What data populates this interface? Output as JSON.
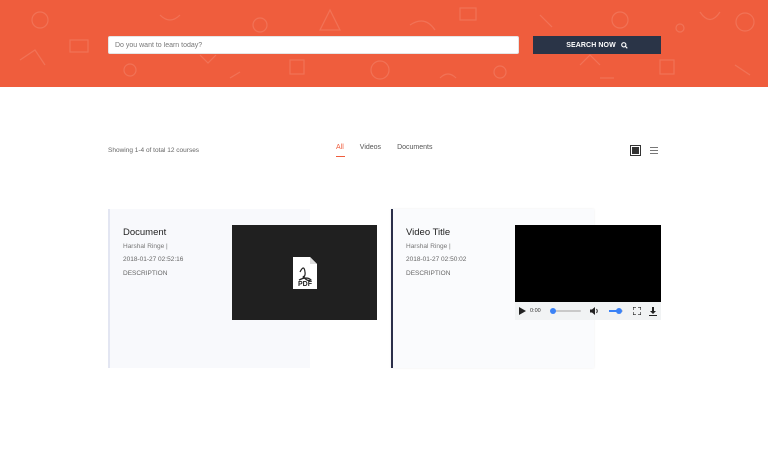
{
  "search": {
    "placeholder": "Do you want to learn today?",
    "button_label": "SEARCH NOW"
  },
  "results": {
    "summary": "Showing 1-4 of total 12 courses"
  },
  "filter_tabs": [
    {
      "label": "All",
      "active": true
    },
    {
      "label": "Videos",
      "active": false
    },
    {
      "label": "Documents",
      "active": false
    }
  ],
  "courses": [
    {
      "type": "document",
      "title": "Document",
      "author": "Harshal Ringe |",
      "date": "2018-01-27 02:52:16",
      "description": "DESCRIPTION",
      "thumbnail_icon": "pdf-file-icon",
      "thumbnail_label": "PDF"
    },
    {
      "type": "video",
      "title": "Video Title",
      "author": "Harshal Ringe |",
      "date": "2018-01-27 02:50:02",
      "description": "DESCRIPTION",
      "player": {
        "current_time": "0:00",
        "progress": 0,
        "volume": 0.7
      }
    }
  ],
  "colors": {
    "brand_orange": "#ef5d3d",
    "dark_navy": "#2a3447",
    "accent_blue": "#3b82f6"
  }
}
